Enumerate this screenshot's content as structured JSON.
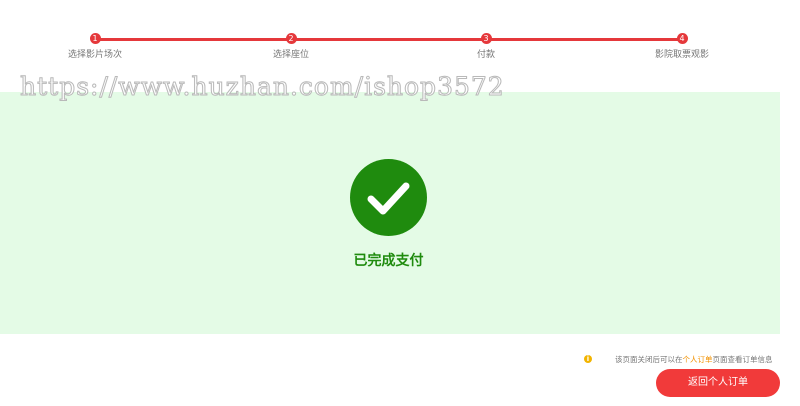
{
  "steps": [
    {
      "number": "1",
      "label": "选择影片场次"
    },
    {
      "number": "2",
      "label": "选择座位"
    },
    {
      "number": "3",
      "label": "付款"
    },
    {
      "number": "4",
      "label": "影院取票观影"
    }
  ],
  "watermark": "https://www.huzhan.com/ishop3572",
  "success": {
    "text": "已完成支付",
    "icon": "checkmark-icon"
  },
  "notice": {
    "icon": "info-icon",
    "prefix": "该页面关闭后可以在",
    "link": "个人订单",
    "suffix": "页面查看订单信息"
  },
  "return_button": "返回个人订单",
  "colors": {
    "accent": "#e5383b",
    "success": "#1f8b0e",
    "success_bg": "#e4fbe6",
    "notice_link": "#f29100",
    "button": "#f13a3a"
  }
}
